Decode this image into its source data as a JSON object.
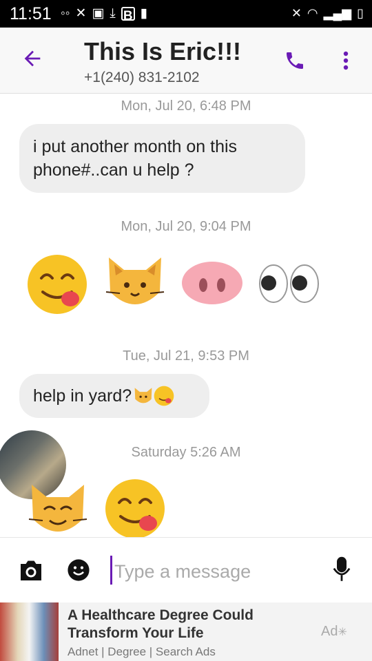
{
  "status_bar": {
    "time": "11:51"
  },
  "header": {
    "title": "This Is Eric!!!",
    "phone": "+1(240) 831-2102"
  },
  "messages": [
    {
      "timestamp": "Mon, Jul 20, 6:48 PM",
      "text": "i put another month on this phone#..can u help ?"
    },
    {
      "timestamp": "Mon, Jul 20, 9:04 PM"
    },
    {
      "timestamp": "Tue, Jul 21, 9:53 PM",
      "text": "help in yard?"
    },
    {
      "timestamp": "Saturday 5:26 AM"
    }
  ],
  "composer": {
    "placeholder": "Type a message"
  },
  "ad": {
    "headline": "A Healthcare Degree Could Transform Your Life",
    "sub": "Adnet | Degree | Search Ads",
    "label": "Ad"
  },
  "colors": {
    "accent": "#6a1bb5",
    "bubble": "#eeeeee"
  },
  "icons": [
    "back-arrow-icon",
    "phone-call-icon",
    "more-vert-icon",
    "camera-icon",
    "emoji-icon",
    "mic-icon"
  ]
}
